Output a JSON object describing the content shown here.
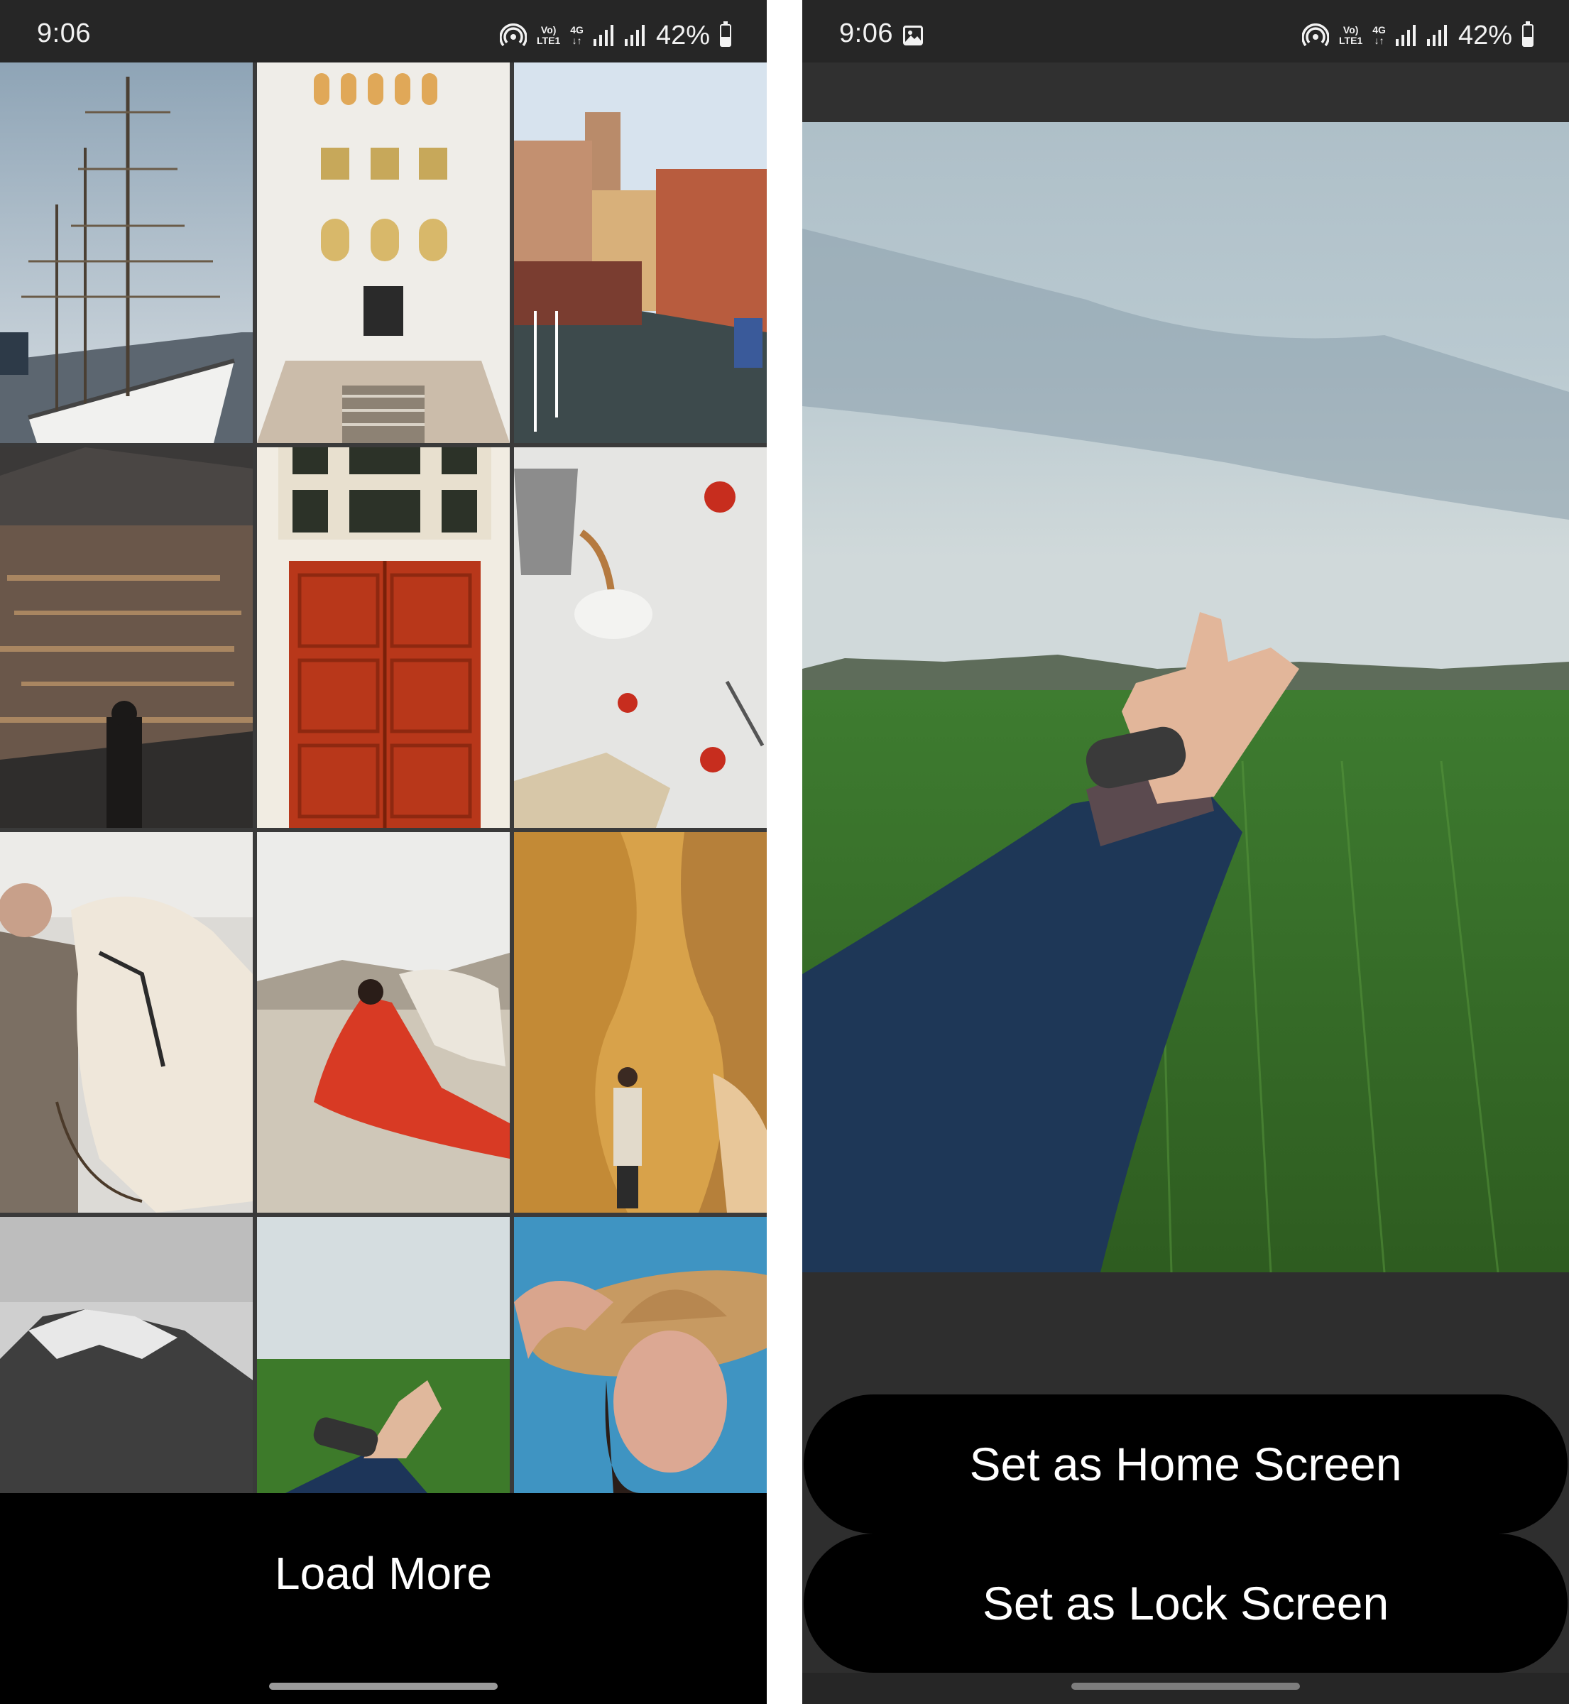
{
  "left_screen": {
    "status": {
      "time": "9:06",
      "net_top": "Vo)",
      "net_bottom": "LTE1",
      "gen_top": "4G",
      "gen_bottom": "↓↑",
      "battery": "42%"
    },
    "photos": [
      {
        "description": "tall ship in harbor"
      },
      {
        "description": "white arched courtyard"
      },
      {
        "description": "venice canal buildings"
      },
      {
        "description": "person overlooking city valley"
      },
      {
        "description": "red wooden door"
      },
      {
        "description": "coffee pouring with strawberries"
      },
      {
        "description": "man with white horse"
      },
      {
        "description": "woman in red dress with horse"
      },
      {
        "description": "man in sandstone canyon"
      },
      {
        "description": "snowy mountain black and white"
      },
      {
        "description": "hand reaching over green field"
      },
      {
        "description": "woman in sun hat"
      }
    ],
    "load_more_label": "Load More"
  },
  "right_screen": {
    "status": {
      "time": "9:06",
      "net_top": "Vo)",
      "net_bottom": "LTE1",
      "gen_top": "4G",
      "gen_bottom": "↓↑",
      "battery": "42%"
    },
    "preview": {
      "description": "hand reaching over green field"
    },
    "set_home_label": "Set as Home Screen",
    "set_lock_label": "Set as Lock Screen"
  },
  "colors": {
    "status_bg": "#262626",
    "button_bg": "#000000",
    "button_text": "#ffffff"
  }
}
